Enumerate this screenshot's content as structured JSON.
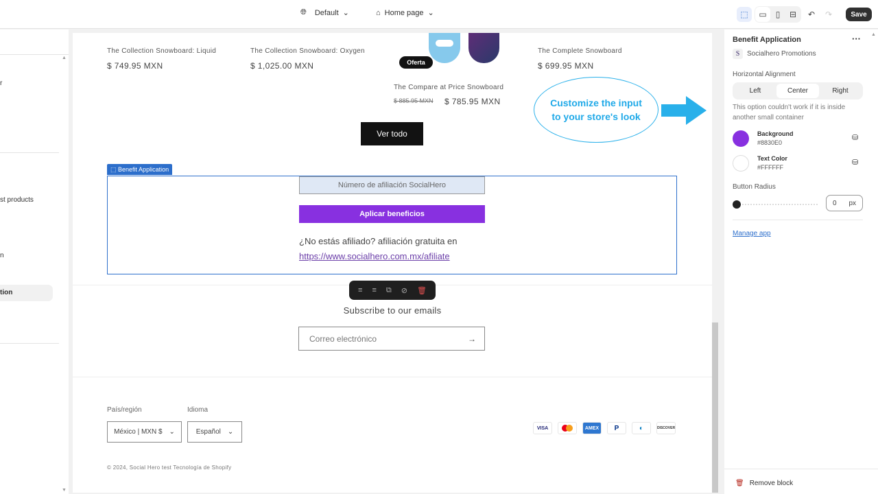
{
  "topbar": {
    "theme_label": "Default",
    "page_label": "Home page",
    "save_label": "Save"
  },
  "left_panel": {
    "items": [
      "r",
      "st products",
      "n",
      "tion"
    ]
  },
  "preview": {
    "products": [
      {
        "title": "The Collection Snowboard: Liquid",
        "price": "$ 749.95 MXN"
      },
      {
        "title": "The Collection Snowboard: Oxygen",
        "price": "$ 1,025.00 MXN"
      },
      {
        "title": "The Compare at Price Snowboard",
        "old_price": "$ 885.95 MXN",
        "price": "$ 785.95 MXN",
        "badge": "Oferta"
      },
      {
        "title": "The Complete Snowboard",
        "price": "$ 699.95 MXN"
      }
    ],
    "view_all": "Ver todo",
    "callout": "Customize the input to your store's look",
    "block_tag": "Benefit Application",
    "benefit": {
      "placeholder": "Número de afiliación SocialHero",
      "button": "Aplicar beneficios",
      "text": "¿No estás afiliado? afiliación gratuita en",
      "link": "https://www.socialhero.com.mx/afiliate",
      "button_color": "#8830E0",
      "button_text_color": "#FFFFFF"
    },
    "subscribe_title": "Subscribe to our emails",
    "email_placeholder": "Correo electrónico",
    "footer": {
      "country_label": "País/región",
      "country_value": "México | MXN $",
      "language_label": "Idioma",
      "language_value": "Español",
      "payments": [
        "VISA",
        "Mastercard",
        "AMEX",
        "PayPal",
        "Diners",
        "DISCOVER"
      ],
      "copyright": "© 2024, Social Hero test Tecnología de Shopify"
    }
  },
  "settings": {
    "title": "Benefit Application",
    "app_name": "Socialhero Promotions",
    "app_initial": "S",
    "alignment_label": "Horizontal Alignment",
    "alignment_options": [
      "Left",
      "Center",
      "Right"
    ],
    "alignment_selected": "Center",
    "alignment_note": "This option couldn't work if it is inside another small container",
    "background_label": "Background",
    "background_value": "#8830E0",
    "text_color_label": "Text Color",
    "text_color_value": "#FFFFFF",
    "radius_label": "Button Radius",
    "radius_value": "0",
    "radius_unit": "px",
    "manage_app": "Manage app",
    "remove_block": "Remove block"
  }
}
